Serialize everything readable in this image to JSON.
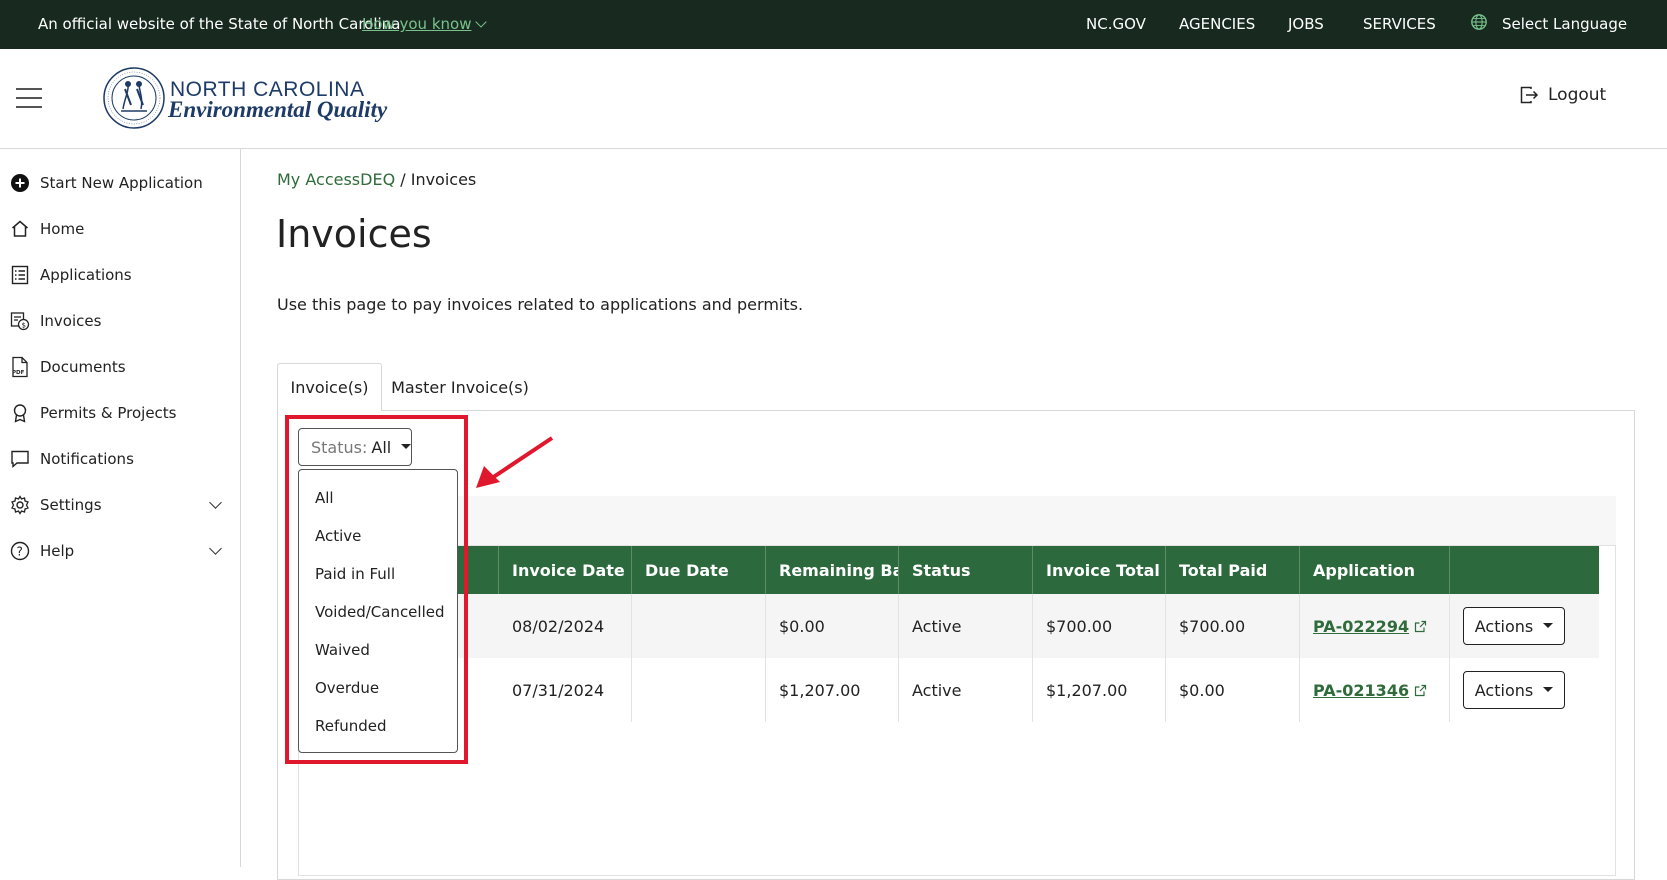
{
  "topbar": {
    "official_text": "An official website of the State of North Carolina",
    "how_you_know": "How you know",
    "nav": [
      "NC.GOV",
      "AGENCIES",
      "JOBS",
      "SERVICES"
    ],
    "language": "Select Language"
  },
  "header": {
    "brand_line1": "NORTH CAROLINA",
    "brand_line2": "Environmental Quality",
    "logout": "Logout"
  },
  "sidebar": {
    "items": [
      {
        "label": "Start New Application",
        "icon": "plus-circle-icon"
      },
      {
        "label": "Home",
        "icon": "home-icon"
      },
      {
        "label": "Applications",
        "icon": "applications-icon"
      },
      {
        "label": "Invoices",
        "icon": "invoices-icon"
      },
      {
        "label": "Documents",
        "icon": "pdf-document-icon"
      },
      {
        "label": "Permits & Projects",
        "icon": "award-icon"
      },
      {
        "label": "Notifications",
        "icon": "chat-icon"
      },
      {
        "label": "Settings",
        "icon": "gear-icon"
      },
      {
        "label": "Help",
        "icon": "help-icon"
      }
    ]
  },
  "main": {
    "breadcrumb_link": "My AccessDEQ",
    "breadcrumb_sep": " / ",
    "breadcrumb_current": "Invoices",
    "title": "Invoices",
    "description": "Use this page to pay invoices related to applications and permits.",
    "tabs": [
      "Invoice(s)",
      "Master Invoice(s)"
    ],
    "status_label": "Status:",
    "status_value": "All",
    "status_options": [
      "All",
      "Active",
      "Paid in Full",
      "Voided/Cancelled",
      "Waived",
      "Overdue",
      "Refunded"
    ]
  },
  "table": {
    "headers": [
      "Invoice Date",
      "Due Date",
      "Remaining Balance",
      "Status",
      "Invoice Total",
      "Total Paid",
      "Application",
      ""
    ],
    "rows": [
      {
        "invoice_date": "08/02/2024",
        "due_date": "",
        "remaining": "$0.00",
        "status": "Active",
        "total": "$700.00",
        "paid": "$700.00",
        "application": "PA-022294",
        "actions": "Actions"
      },
      {
        "invoice_date": "07/31/2024",
        "due_date": "",
        "remaining": "$1,207.00",
        "status": "Active",
        "total": "$1,207.00",
        "paid": "$0.00",
        "application": "PA-021346",
        "actions": "Actions"
      }
    ]
  },
  "colors": {
    "topbar_bg": "#182a20",
    "table_header_bg": "#2c6a3d",
    "link_green": "#2f6b3b",
    "highlight_red": "#e0182d",
    "brand_blue": "#1d3b66"
  }
}
